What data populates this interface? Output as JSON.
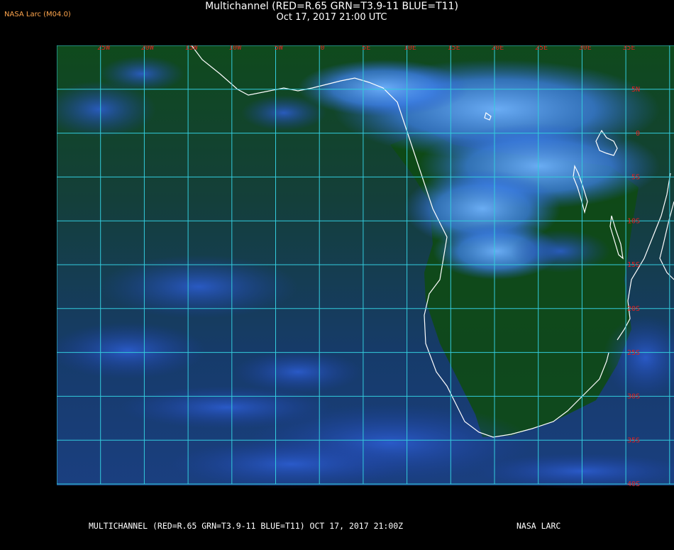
{
  "header": {
    "brand": "NASA Larc (M04.0)",
    "title": "Multichannel (RED=R.65 GRN=T3.9-11 BLUE=T11)",
    "subtitle": "Oct 17, 2017 21:00 UTC"
  },
  "map": {
    "lon_labels": [
      "25W",
      "20W",
      "15W",
      "10W",
      "5W",
      "0",
      "5E",
      "10E",
      "15E",
      "20E",
      "25E",
      "30E",
      "35E"
    ],
    "lat_labels": [
      "5N",
      "0",
      "5S",
      "10S",
      "15S",
      "20S",
      "25S",
      "30S",
      "35S",
      "40S"
    ],
    "colors": {
      "grid": "#33ccdd",
      "label": "#e02020",
      "coastline": "#ffffff",
      "background": "#0c3d14",
      "ocean_tint": "#123a6e",
      "cloud": "#2a6cf0",
      "cloud_bright": "#5aa6ff"
    }
  },
  "footer": {
    "left": "MULTICHANNEL (RED=R.65 GRN=T3.9-11 BLUE=T11) OCT 17, 2017 21:00Z",
    "right": "NASA LARC"
  }
}
